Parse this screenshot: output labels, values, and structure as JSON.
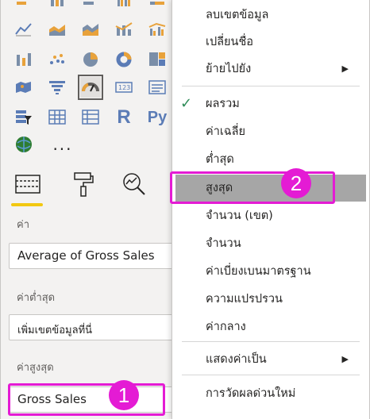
{
  "viz_pane": {
    "fields_well": {
      "values_label": "ค่า",
      "values_field": "Average of Gross Sales",
      "min_label": "ค่าต่ำสุด",
      "min_placeholder": "เพิ่มเขตข้อมูลที่นี่",
      "max_label": "ค่าสูงสุด",
      "max_field": "Gross Sales"
    },
    "more_visuals_label": "...",
    "r_visual_label": "R",
    "python_visual_label": "Py"
  },
  "context_menu": {
    "items": [
      {
        "label": "ลบเขตข้อมูล"
      },
      {
        "label": "เปลี่ยนชื่อ"
      },
      {
        "label": "ย้ายไปยัง",
        "submenu": true
      },
      {
        "label": "ผลรวม",
        "checked": true
      },
      {
        "label": "ค่าเฉลี่ย"
      },
      {
        "label": "ต่ำสุด"
      },
      {
        "label": "สูงสุด",
        "hovered": true
      },
      {
        "label": "จำนวน (เขต)"
      },
      {
        "label": "จำนวน"
      },
      {
        "label": "ค่าเบี่ยงเบนมาตรฐาน"
      },
      {
        "label": "ความแปรปรวน"
      },
      {
        "label": "ค่ากลาง"
      },
      {
        "label": "แสดงค่าเป็น",
        "submenu": true
      },
      {
        "label": "การวัดผลด่วนใหม่"
      }
    ],
    "check_glyph": "✓",
    "submenu_glyph": "▶"
  },
  "callouts": {
    "step1": "1",
    "step2": "2"
  },
  "colors": {
    "callout": "#e41bd4",
    "hover": "#a6a6a6",
    "check": "#2e8b57",
    "tab_underline": "#f2c811"
  }
}
